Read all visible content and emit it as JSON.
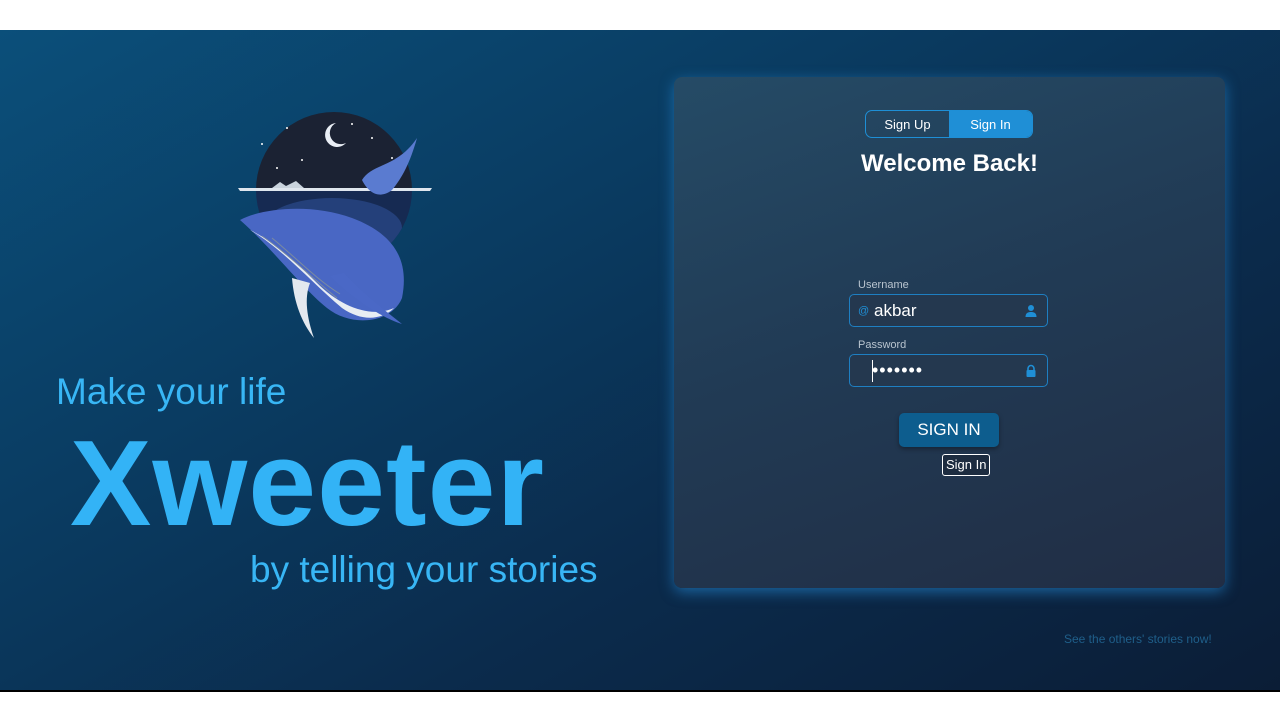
{
  "hero": {
    "tagline_top": "Make your life",
    "brand": "Xweeter",
    "tagline_bottom": "by telling your stories",
    "logo_icon": "whale-moon-logo"
  },
  "auth": {
    "tabs": [
      {
        "label": "Sign Up",
        "active": false
      },
      {
        "label": "Sign In",
        "active": true
      }
    ],
    "welcome": "Welcome Back!",
    "username": {
      "label": "Username",
      "prefix": "@",
      "value": "akbar",
      "icon": "user-icon"
    },
    "password": {
      "label": "Password",
      "value": "•••••••",
      "icon": "lock-icon"
    },
    "submit_label": "SIGN IN",
    "tooltip": "Sign In"
  },
  "footer": {
    "others_link": "See the others' stories now!"
  },
  "colors": {
    "accent": "#1f8fd6",
    "brand_text": "#33b3f6",
    "button": "#0d5d8e"
  }
}
